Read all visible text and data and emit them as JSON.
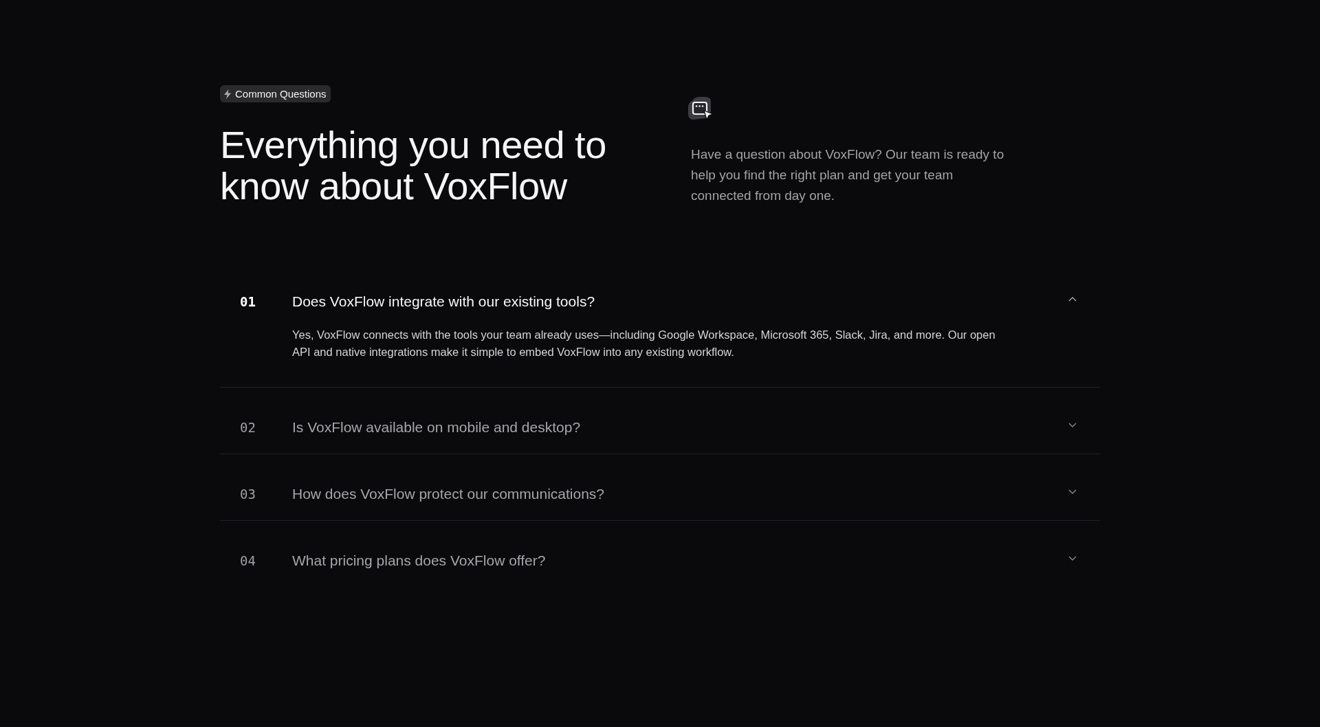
{
  "badge": {
    "label": "Common Questions"
  },
  "heading": "Everything you need to know about VoxFlow",
  "intro": "Have a question about VoxFlow? Our team is ready to help you find the right plan and get your team connected from day one.",
  "faq": [
    {
      "number": "01",
      "question": "Does VoxFlow integrate with our existing tools?",
      "expanded": true,
      "answer": "Yes, VoxFlow connects with the tools your team already uses—including Google Workspace, Microsoft 365, Slack, Jira, and more. Our open API and native integrations make it simple to embed VoxFlow into any existing workflow."
    },
    {
      "number": "02",
      "question": "Is VoxFlow available on mobile and desktop?",
      "expanded": false
    },
    {
      "number": "03",
      "question": "How does VoxFlow protect our communications?",
      "expanded": false
    },
    {
      "number": "04",
      "question": "What pricing plans does VoxFlow offer?",
      "expanded": false
    }
  ]
}
